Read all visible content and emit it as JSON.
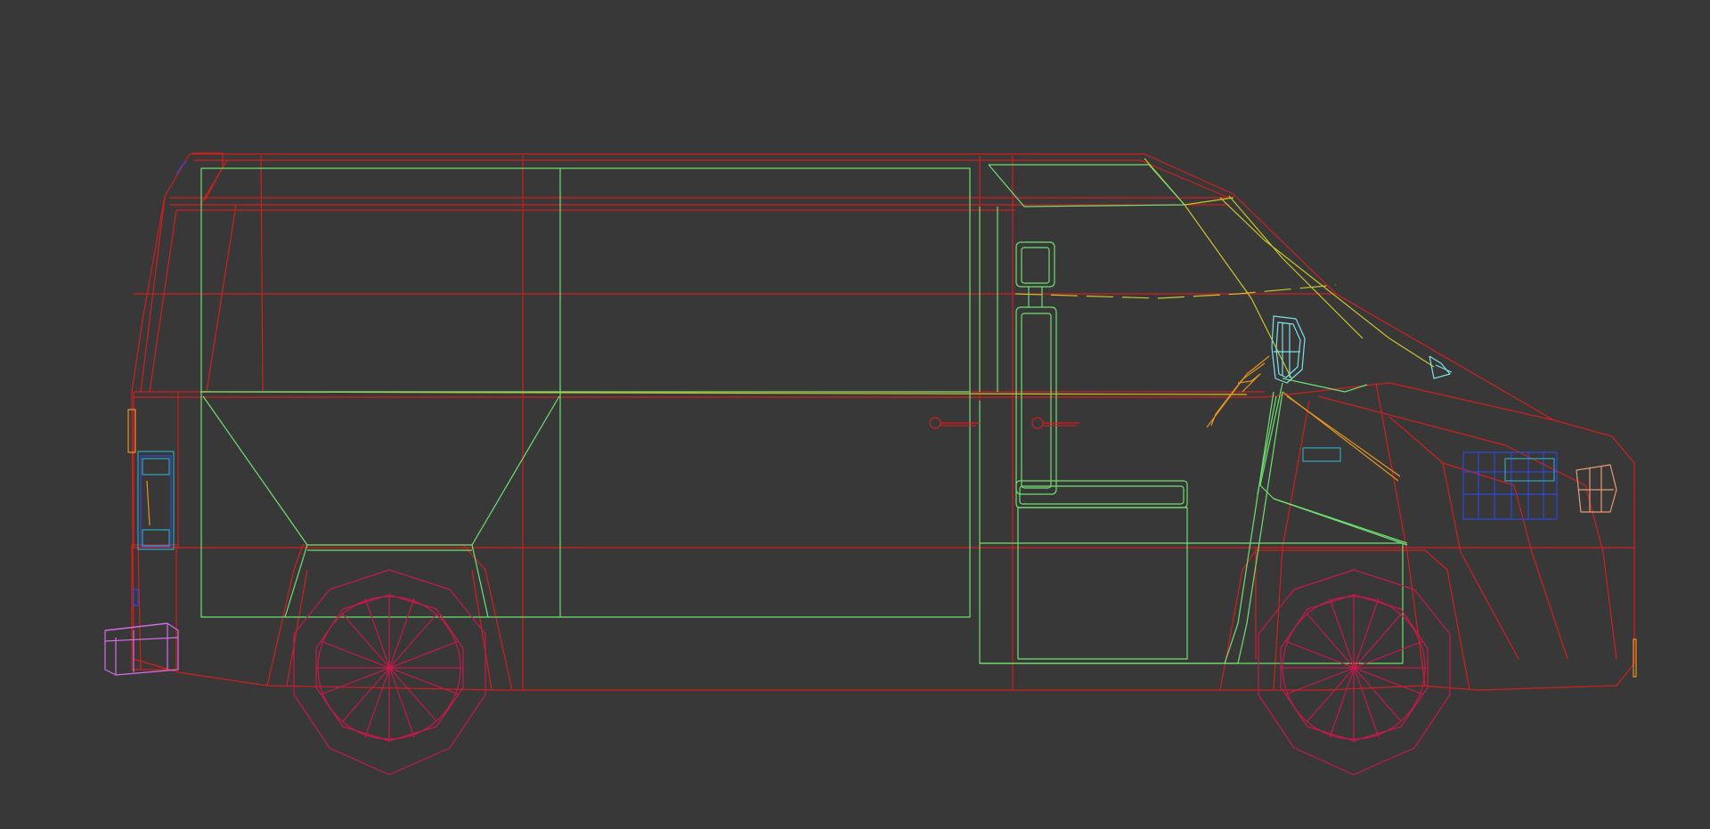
{
  "viewport": {
    "background": "#383838",
    "model": "van-wireframe",
    "colors": {
      "body": "#d11f1f",
      "interior": "#6fe06f",
      "trim": "#c9c42a",
      "wheels": "#c41a4a",
      "mirror": "#7ee0e8",
      "wiper": "#e69422",
      "headlight": "#2f47d6",
      "taillight": "#2fa3b8",
      "tow_hitch": "#d56ee6",
      "indicator": "#e89a72"
    }
  }
}
